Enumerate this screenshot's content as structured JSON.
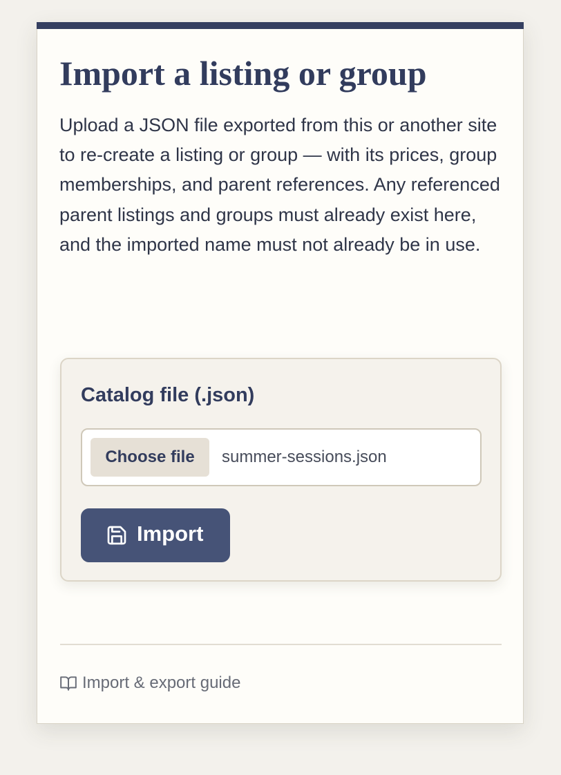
{
  "page": {
    "title": "Import a listing or group",
    "description": "Upload a JSON file exported from this or another site to re-create a listing or group — with its prices, group memberships, and parent references. Any referenced parent listings and groups must already exist here, and the imported name must not already be in use."
  },
  "upload_form": {
    "field_label": "Catalog file (.json)",
    "choose_file_label": "Choose file",
    "selected_file_name": "summer-sessions.json",
    "submit_label": "Import",
    "submit_icon": "save-icon"
  },
  "footer": {
    "guide_link_label": "Import & export guide",
    "guide_link_icon": "book-open-icon"
  },
  "colors": {
    "page_background": "#f3f1ec",
    "card_background": "#fefdf9",
    "accent_bar": "#353f60",
    "heading": "#323c5d",
    "primary_button": "#465377",
    "panel_background": "#f5f2ec",
    "muted_text": "#676b76"
  }
}
